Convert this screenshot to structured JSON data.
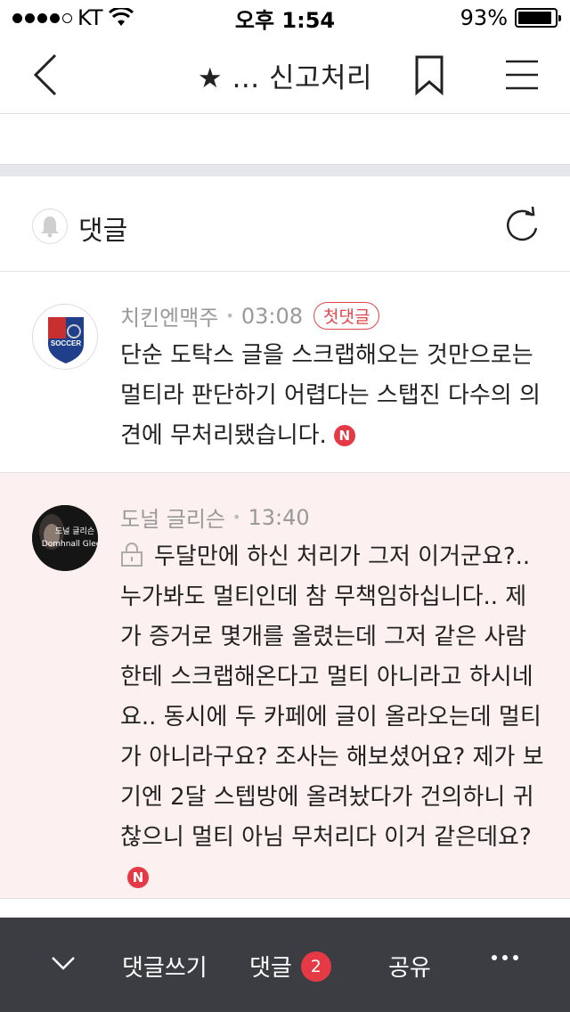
{
  "status_bar": {
    "carrier": "KT",
    "time": "오후 1:54",
    "battery": "93%",
    "battery_level": 0.93
  },
  "nav": {
    "title": "★ ... 신고처리"
  },
  "comments_section": {
    "title": "댓글"
  },
  "comments": [
    {
      "author": "치킨엔맥주",
      "time": "03:08",
      "badge": "첫댓글",
      "text": "단순 도탁스 글을 스크랩해오는 것만으로는 멀티라 판단하기 어렵다는 스탭진 다수의 의견에 무처리됐습니다.",
      "new_badge": "N",
      "avatar_text": "SOCCER"
    },
    {
      "author": "도널 글리슨",
      "time": "13:40",
      "text": "두달만에 하신 처리가 그저 이거군요?.. 누가봐도 멀티인데 참 무책임하십니다.. 제가 증거로 몇개를 올렸는데 그저 같은 사람한테 스크랩해온다고 멀티 아니라고 하시네요.. 동시에 두 카페에 글이 올라오는데 멀티가 아니라구요? 조사는 해보셨어요? 제가 보기엔 2달 스텝방에 올려놨다가 건의하니 귀찮으니 멀티 아님 무처리다 이거 같은데요?",
      "new_badge": "N",
      "avatar_text": "도널 글리슨",
      "avatar_text2": "Domhnall Gleeson"
    }
  ],
  "bottom_bar": {
    "write": "댓글쓰기",
    "comments": "댓글",
    "comment_count": "2",
    "share": "공유"
  }
}
